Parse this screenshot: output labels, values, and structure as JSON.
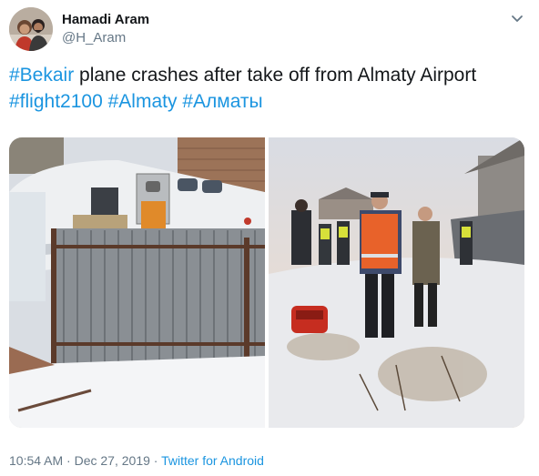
{
  "author": {
    "name": "Hamadi Aram",
    "handle": "@H_Aram"
  },
  "tweet": {
    "hashtag_1": "#Bekair",
    "text_1": " plane crashes after take off from Almaty Airport",
    "hashtag_2": "#flight2100",
    "hashtag_3": "#Almaty",
    "hashtag_4": "#Алматы"
  },
  "footer": {
    "time": "10:54 AM",
    "separator_1": " · ",
    "date": "Dec 27, 2019",
    "separator_2": " · ",
    "source": "Twitter for Android"
  },
  "icons": {
    "menu": "chevron-down-icon"
  },
  "colors": {
    "link": "#1b95e0",
    "secondary": "#657786",
    "primary_text": "#14171a"
  }
}
